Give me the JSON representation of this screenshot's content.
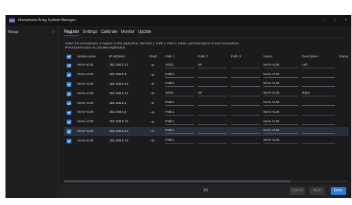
{
  "window": {
    "title": "Microphone Array System Manager",
    "logo_text": "MAS",
    "minimize": "–",
    "maximize": "□",
    "close": "×"
  },
  "sidebar": {
    "group_label": "Group",
    "toggle_icon": "◇"
  },
  "tabs": [
    {
      "label": "Register",
      "active": true
    },
    {
      "label": "Settings",
      "active": false
    },
    {
      "label": "Calibrate",
      "active": false
    },
    {
      "label": "Monitor",
      "active": false
    },
    {
      "label": "Update",
      "active": false
    }
  ],
  "instructions": {
    "line1": "Select the microphones to register in this application. Set Path 1, Path 2, Path 3, Name, and Description of each microphone.",
    "line2": "Press Done button to complete registration."
  },
  "columns": {
    "model": "Model name",
    "ip": "IP address",
    "flash": "Flash",
    "path1": "Path 1",
    "path2": "Path 2",
    "path3": "Path 3",
    "name": "Name",
    "description": "Description",
    "status": "Status"
  },
  "rows": [
    {
      "model": "MAS-A100",
      "ip": "192.168.0.32",
      "flash": "-≋-",
      "path1": "103G",
      "path2": "6F",
      "path3": "",
      "name": "MAS-A100",
      "description": "Left",
      "selected": false
    },
    {
      "model": "MAS-A100",
      "ip": "192.168.0.8",
      "flash": "-≋-",
      "path1": "Path1",
      "path2": "",
      "path3": "",
      "name": "MAS-A100",
      "description": "",
      "selected": false
    },
    {
      "model": "MAS-A100",
      "ip": "192.168.0.43",
      "flash": "-≋-",
      "path1": "Path1",
      "path2": "",
      "path3": "",
      "name": "MAS-A100",
      "description": "",
      "selected": false
    },
    {
      "model": "MAS-A100",
      "ip": "192.168.0.42",
      "flash": "-≋-",
      "path1": "103G",
      "path2": "6F",
      "path3": "",
      "name": "MAS-A100",
      "description": "Right",
      "selected": false
    },
    {
      "model": "MAS-A100",
      "ip": "192.168.0.2",
      "flash": "-≋-",
      "path1": "Path1",
      "path2": "",
      "path3": "",
      "name": "MAS-A100",
      "description": "",
      "selected": false
    },
    {
      "model": "MAS-A100",
      "ip": "192.168.0.5",
      "flash": "-≋-",
      "path1": "Path1",
      "path2": "",
      "path3": "",
      "name": "MAS-A100",
      "description": "",
      "selected": false
    },
    {
      "model": "MAS-A100",
      "ip": "192.168.0.15",
      "flash": "-≋-",
      "path1": "Path1",
      "path2": "",
      "path3": "",
      "name": "MAS-A100",
      "description": "",
      "selected": false
    },
    {
      "model": "MAS-A100",
      "ip": "192.168.0.34",
      "flash": "-≋-",
      "path1": "Path1",
      "path2": "",
      "path3": "",
      "name": "MAS-A100",
      "description": "",
      "selected": true
    },
    {
      "model": "MAS-A100",
      "ip": "192.168.0.78",
      "flash": "-≋-",
      "path1": "Path1",
      "path2": "",
      "path3": "",
      "name": "MAS-A100",
      "description": "",
      "selected": false
    }
  ],
  "footer": {
    "page": "3/3",
    "cancel": "Cancel",
    "back": "Back",
    "done": "Done"
  },
  "colors": {
    "accent": "#2e7cd6",
    "background": "#1b1b1d",
    "selected_row": "#26303d"
  }
}
